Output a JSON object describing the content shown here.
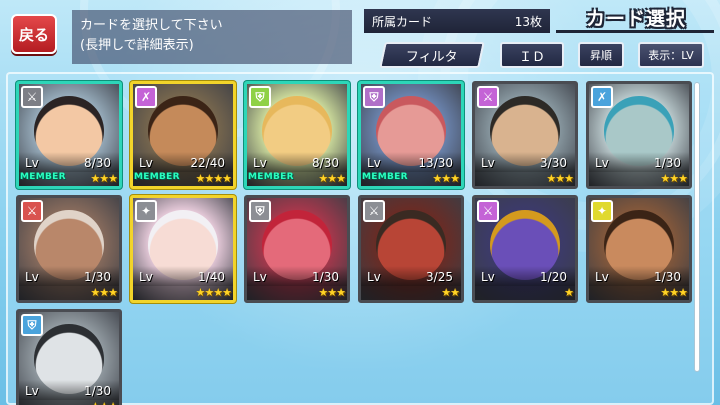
{
  "header": {
    "back_label": "戻る",
    "instruction_line1": "カードを選択して下さい",
    "instruction_line2": "(長押しで詳細表示)",
    "owned_label": "所属カード",
    "owned_count": "13枚",
    "title": "カード選択",
    "filter_label": "フィルタ",
    "id_label": "ＩＤ",
    "order_label": "昇順",
    "display_label": "表示：LV"
  },
  "cards": [
    {
      "lv_label": "Lv",
      "lv_value": "8/30",
      "member": "MEMBER",
      "stars": "★★★",
      "frame": "member",
      "type_color": "#7d7f86",
      "type_icon": "sword-icon",
      "face_color": "#f3c8a4",
      "bg_color": "#9fb6c6",
      "hair_color": "#2b2424"
    },
    {
      "lv_label": "Lv",
      "lv_value": "22/40",
      "member": "MEMBER",
      "stars": "★★★★",
      "frame": "gold",
      "type_color": "#c463d6",
      "type_icon": "axe-icon",
      "face_color": "#c58a5a",
      "bg_color": "#7c6a4e",
      "hair_color": "#3b2416"
    },
    {
      "lv_label": "Lv",
      "lv_value": "8/30",
      "member": "MEMBER",
      "stars": "★★★",
      "frame": "member",
      "type_color": "#8fd146",
      "type_icon": "shield-icon",
      "face_color": "#f2cc83",
      "bg_color": "#d8e8a2",
      "hair_color": "#e7b85c"
    },
    {
      "lv_label": "Lv",
      "lv_value": "13/30",
      "member": "MEMBER",
      "stars": "★★★",
      "frame": "member",
      "type_color": "#b070c8",
      "type_icon": "shield-icon",
      "face_color": "#e69a96",
      "bg_color": "#6f8ab8",
      "hair_color": "#c9595e"
    },
    {
      "lv_label": "Lv",
      "lv_value": "3/30",
      "member": "",
      "stars": "★★★",
      "frame": "normal",
      "type_color": "#c463d6",
      "type_icon": "sword-icon",
      "face_color": "#d9b38f",
      "bg_color": "#8fa0a8",
      "hair_color": "#2d2a26"
    },
    {
      "lv_label": "Lv",
      "lv_value": "1/30",
      "member": "",
      "stars": "★★★",
      "frame": "normal",
      "type_color": "#4aa3dc",
      "type_icon": "axe-icon",
      "face_color": "#a9c8c8",
      "bg_color": "#c5d6d8",
      "hair_color": "#3aa1b8"
    },
    {
      "lv_label": "Lv",
      "lv_value": "1/30",
      "member": "",
      "stars": "★★★",
      "frame": "normal",
      "type_color": "#d9534f",
      "type_icon": "sword-icon",
      "face_color": "#b9876a",
      "bg_color": "#8e6f5e",
      "hair_color": "#e0d3c8"
    },
    {
      "lv_label": "Lv",
      "lv_value": "1/40",
      "member": "",
      "stars": "★★★★",
      "frame": "gold",
      "type_color": "#8c8e94",
      "type_icon": "staff-icon",
      "face_color": "#f7dcd5",
      "bg_color": "#f5d6e6",
      "hair_color": "#f2f0f4"
    },
    {
      "lv_label": "Lv",
      "lv_value": "1/30",
      "member": "",
      "stars": "★★★",
      "frame": "normal",
      "type_color": "#8c8e94",
      "type_icon": "shield-icon",
      "face_color": "#e46a7a",
      "bg_color": "#b0374c",
      "hair_color": "#c2243a"
    },
    {
      "lv_label": "Lv",
      "lv_value": "3/25",
      "member": "",
      "stars": "★★",
      "frame": "normal",
      "type_color": "#8c8e94",
      "type_icon": "sword-icon",
      "face_color": "#b84536",
      "bg_color": "#6e2a22",
      "hair_color": "#3a2a22"
    },
    {
      "lv_label": "Lv",
      "lv_value": "1/20",
      "member": "",
      "stars": "★",
      "frame": "normal",
      "type_color": "#c463d6",
      "type_icon": "sword-icon",
      "face_color": "#6a4fb8",
      "bg_color": "#3c3a6e",
      "hair_color": "#d49a1e"
    },
    {
      "lv_label": "Lv",
      "lv_value": "1/30",
      "member": "",
      "stars": "★★★",
      "frame": "normal",
      "type_color": "#e0d92e",
      "type_icon": "staff-icon",
      "face_color": "#c98a5e",
      "bg_color": "#8a5a3a",
      "hair_color": "#3b2416"
    },
    {
      "lv_label": "Lv",
      "lv_value": "1/30",
      "member": "",
      "stars": "★★★",
      "frame": "normal",
      "type_color": "#4aa3dc",
      "type_icon": "shield-icon",
      "face_color": "#dfe3e6",
      "bg_color": "#9aa4aa",
      "hair_color": "#2c2f33"
    }
  ]
}
